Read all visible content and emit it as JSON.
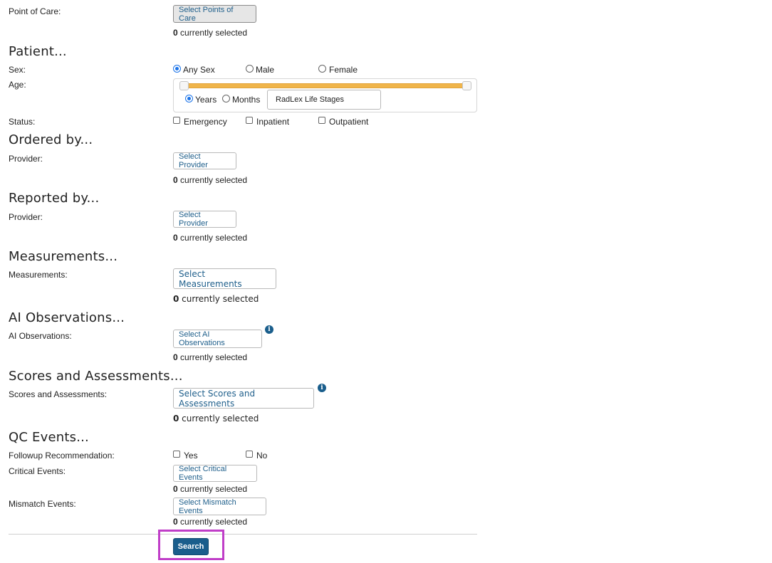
{
  "point_of_care": {
    "label": "Point of Care:",
    "button": "Select Points of Care",
    "count": "0",
    "count_suffix": " currently selected"
  },
  "patient": {
    "heading": "Patient...",
    "sex_label": "Sex:",
    "sex_options": [
      "Any Sex",
      "Male",
      "Female"
    ],
    "sex_selected": "Any Sex",
    "age_label": "Age:",
    "age_units": [
      "Years",
      "Months"
    ],
    "age_unit_selected": "Years",
    "age_stages_button": "RadLex Life Stages",
    "status_label": "Status:",
    "status_options": [
      "Emergency",
      "Inpatient",
      "Outpatient"
    ]
  },
  "ordered_by": {
    "heading": "Ordered by...",
    "label": "Provider:",
    "button": "Select Provider",
    "count": "0",
    "count_suffix": " currently selected"
  },
  "reported_by": {
    "heading": "Reported by...",
    "label": "Provider:",
    "button": "Select Provider",
    "count": "0",
    "count_suffix": " currently selected"
  },
  "measurements": {
    "heading": "Measurements...",
    "label": "Measurements:",
    "button": "Select Measurements",
    "count": "0",
    "count_suffix": " currently selected"
  },
  "ai_observations": {
    "heading": "AI Observations...",
    "label": "AI Observations:",
    "button": "Select AI Observations",
    "count": "0",
    "count_suffix": " currently selected"
  },
  "scores": {
    "heading": "Scores and Assessments...",
    "label": "Scores and Assessments:",
    "button": "Select Scores and Assessments",
    "count": "0",
    "count_suffix": " currently selected"
  },
  "qc_events": {
    "heading": "QC Events...",
    "followup_label": "Followup Recommendation:",
    "followup_options": [
      "Yes",
      "No"
    ],
    "critical_label": "Critical Events:",
    "critical_button": "Select Critical Events",
    "critical_count": "0",
    "critical_count_suffix": " currently selected",
    "mismatch_label": "Mismatch Events:",
    "mismatch_button": "Select Mismatch Events",
    "mismatch_count": "0",
    "mismatch_count_suffix": " currently selected"
  },
  "search_button": "Search",
  "colors": {
    "accent": "#1a5e8c",
    "slider_fill": "#f0b54a",
    "highlight_box": "#c03ec8"
  }
}
